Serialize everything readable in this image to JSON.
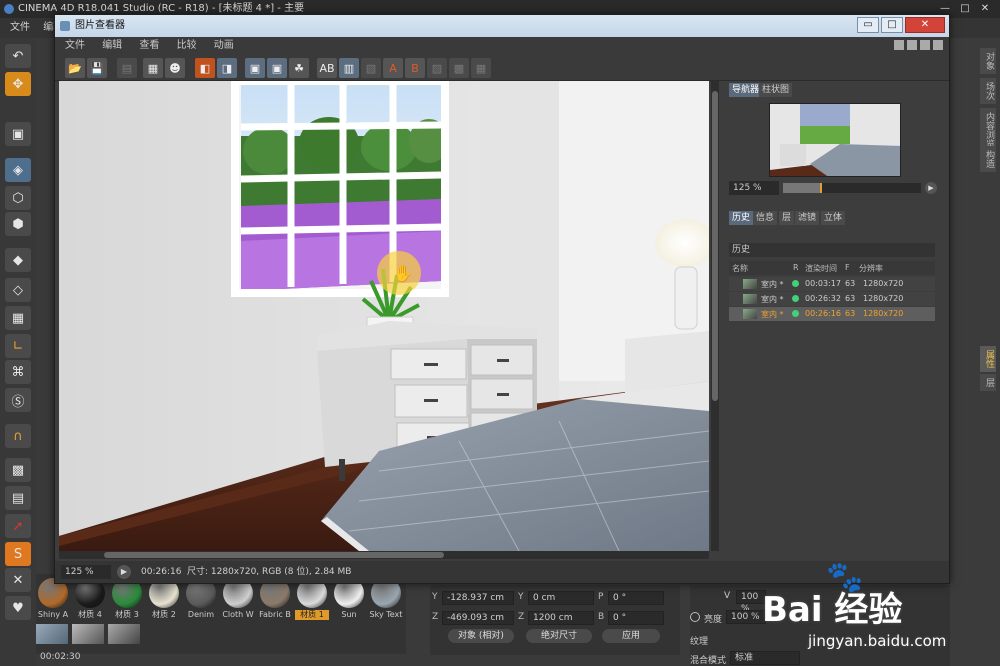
{
  "app": {
    "title": "CINEMA 4D R18.041 Studio (RC - R18) - [未标题 4 *] - 主要",
    "menu": [
      "文件",
      "编辑"
    ],
    "controls": [
      "—",
      "□",
      "✕"
    ]
  },
  "left_toolbar": {
    "icons": [
      "undo-icon",
      "move-icon",
      "model-icon",
      "texture-icon",
      "point-icon",
      "edge-icon",
      "polygon-icon",
      "axis-icon",
      "mouse-icon",
      "snap-icon",
      "magnet-icon",
      "grid-icon",
      "grid2-icon",
      "arrow-icon",
      "s-icon",
      "lock-icon",
      "heart-icon"
    ]
  },
  "right_strip": {
    "tabs": [
      "对象",
      "场次",
      "内容浏览器",
      "构造",
      "属性",
      "层"
    ]
  },
  "viewer": {
    "title": "图片查看器",
    "menu": [
      "文件",
      "编辑",
      "查看",
      "比较",
      "动画"
    ],
    "window_controls": [
      "▭",
      "□",
      "✕"
    ],
    "toolbar_icons": [
      "open-icon",
      "save-icon",
      "save-as-icon",
      "render-icon",
      "copy-icon",
      "paste-icon",
      "compare-icon",
      "ab-icon",
      "a-icon",
      "b-icon",
      "channel-icon",
      "filter-icon",
      "clear-icon"
    ],
    "status": {
      "zoom": "125 %",
      "time": "00:26:16",
      "info": "尺寸: 1280x720, RGB (8 位), 2.84 MB"
    },
    "right_panel": {
      "top_tabs": [
        "导航器",
        "柱状图"
      ],
      "nav_zoom": "125 %",
      "zoom_fraction": 0.27,
      "lower_tabs": [
        "历史",
        "信息",
        "层",
        "滤镜",
        "立体"
      ],
      "section_title": "历史",
      "columns": [
        "名称",
        "R",
        "渲染时间",
        "F",
        "分辨率"
      ],
      "rows": [
        {
          "name": "室内 *",
          "time": "00:03:17",
          "frames": "63",
          "res": "1280x720",
          "selected": false
        },
        {
          "name": "室内 *",
          "time": "00:26:32",
          "frames": "63",
          "res": "1280x720",
          "selected": false
        },
        {
          "name": "室内 *",
          "time": "00:26:16",
          "frames": "63",
          "res": "1280x720",
          "selected": true
        }
      ]
    }
  },
  "materials": {
    "items": [
      {
        "label": "Shiny A",
        "color": "#b06a2a"
      },
      {
        "label": "材质 4",
        "color": "#1a1a1a"
      },
      {
        "label": "材质 3",
        "color": "#2a8a3a"
      },
      {
        "label": "材质 2",
        "color": "#e8e2d0"
      },
      {
        "label": "Denim",
        "color": "#5a5a5a"
      },
      {
        "label": "Cloth W",
        "color": "#cfcfcf"
      },
      {
        "label": "Fabric B",
        "color": "#8a7a6a"
      },
      {
        "label": "材质 1",
        "color": "#dcdcdc"
      },
      {
        "label": "Sun",
        "color": "#f0f0f0"
      },
      {
        "label": "Sky Text",
        "color": "#9aa6b0"
      }
    ],
    "selected_index": 7
  },
  "coordinates": {
    "rows": [
      {
        "axis_a": "Y",
        "a": "-128.937 cm",
        "axis_b": "Y",
        "b": "0 cm",
        "axis_c": "P",
        "c": "0 °"
      },
      {
        "axis_a": "Z",
        "a": "-469.093 cm",
        "axis_b": "Z",
        "b": "1200 cm",
        "axis_c": "B",
        "c": "0 °"
      }
    ],
    "mode1": "对象 (相对)",
    "mode2": "绝对尺寸",
    "apply": "应用"
  },
  "attributes": {
    "v_label": "V",
    "v_value": "100 %",
    "brightness_label": "亮度",
    "brightness_value": "100 %",
    "texture_label": "纹理",
    "blend_label": "混合模式",
    "blend_value": "标准"
  },
  "bottom_time": "00:02:30",
  "watermark": {
    "brand": "Bai 经验",
    "url": "jingyan.baidu.com"
  }
}
